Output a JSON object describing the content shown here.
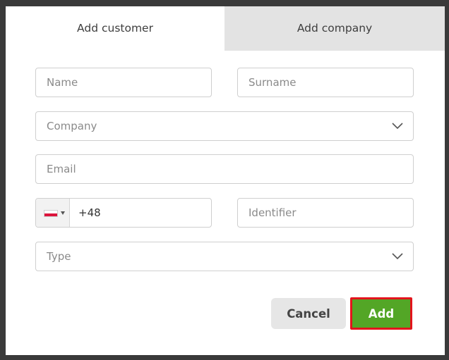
{
  "tabs": {
    "add_customer": "Add customer",
    "add_company": "Add company"
  },
  "form": {
    "name_placeholder": "Name",
    "surname_placeholder": "Surname",
    "company_placeholder": "Company",
    "email_placeholder": "Email",
    "phone_country_flag": "poland-flag-icon",
    "phone_value": "+48",
    "identifier_placeholder": "Identifier",
    "type_placeholder": "Type"
  },
  "actions": {
    "cancel_label": "Cancel",
    "add_label": "Add"
  },
  "colors": {
    "add_button": "#53a626",
    "add_button_highlight": "#e3141c",
    "inactive_tab": "#e3e3e3"
  }
}
